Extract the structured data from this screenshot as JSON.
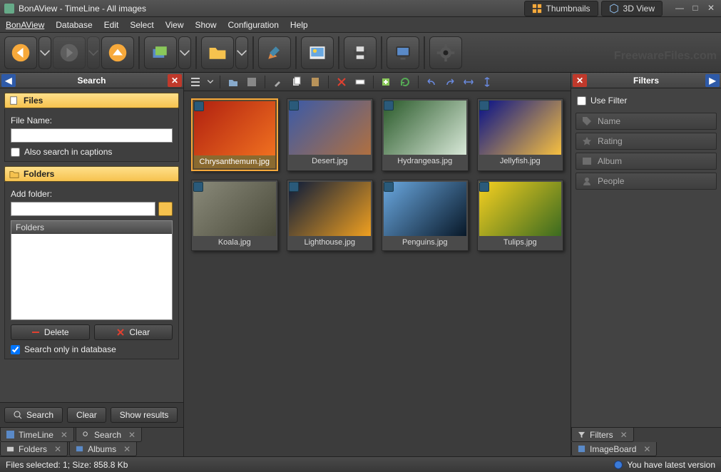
{
  "window": {
    "title": "BonAView - TimeLine - All images"
  },
  "viewTabs": {
    "thumbnails": "Thumbnails",
    "threed": "3D View"
  },
  "menu": {
    "app": "BonAView",
    "database": "Database",
    "edit": "Edit",
    "select": "Select",
    "view": "View",
    "show": "Show",
    "configuration": "Configuration",
    "help": "Help"
  },
  "searchPanel": {
    "title": "Search",
    "filesHdr": "Files",
    "fileNameLabel": "File Name:",
    "fileNameValue": "",
    "alsoCaptions": "Also search in captions",
    "foldersHdr": "Folders",
    "addFolderLabel": "Add folder:",
    "addFolderValue": "",
    "foldersListHdr": "Folders",
    "deleteBtn": "Delete",
    "clearBtn": "Clear",
    "searchOnlyDb": "Search only in database",
    "searchBtn": "Search",
    "clearBtn2": "Clear",
    "showResultsBtn": "Show results"
  },
  "leftTabs": {
    "timeline": "TimeLine",
    "search": "Search",
    "folders": "Folders",
    "albums": "Albums"
  },
  "filtersPanel": {
    "title": "Filters",
    "useFilter": "Use Filter",
    "rows": {
      "name": "Name",
      "rating": "Rating",
      "album": "Album",
      "people": "People"
    }
  },
  "rightTabs": {
    "filters": "Filters",
    "imageboard": "ImageBoard"
  },
  "thumbs": [
    {
      "label": "Chrysanthemum.jpg",
      "selected": true,
      "c1": "#b02010",
      "c2": "#f07020"
    },
    {
      "label": "Desert.jpg",
      "selected": false,
      "c1": "#3a5aa8",
      "c2": "#b07040"
    },
    {
      "label": "Hydrangeas.jpg",
      "selected": false,
      "c1": "#2a5a2a",
      "c2": "#d8e8d8"
    },
    {
      "label": "Jellyfish.jpg",
      "selected": false,
      "c1": "#06108a",
      "c2": "#f7c040"
    },
    {
      "label": "Koala.jpg",
      "selected": false,
      "c1": "#8a8a7a",
      "c2": "#4a4a3a"
    },
    {
      "label": "Lighthouse.jpg",
      "selected": false,
      "c1": "#0a1a3a",
      "c2": "#f0a020"
    },
    {
      "label": "Penguins.jpg",
      "selected": false,
      "c1": "#6aa8e0",
      "c2": "#081828"
    },
    {
      "label": "Tulips.jpg",
      "selected": false,
      "c1": "#f6d020",
      "c2": "#3a6a20"
    }
  ],
  "status": {
    "left": "Files selected: 1; Size: 858.8 Kb",
    "update": "You have latest version"
  },
  "watermark": "FreewareFiles.com"
}
